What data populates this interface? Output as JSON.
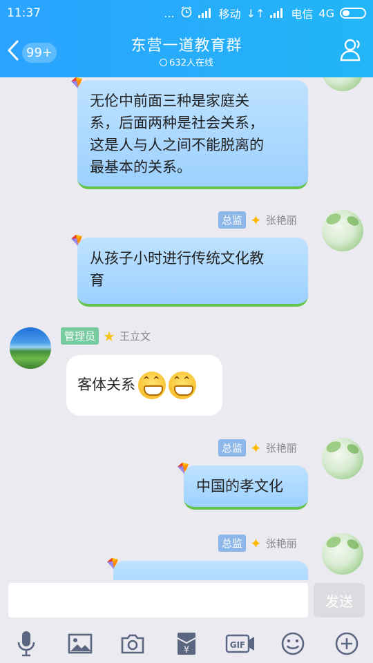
{
  "status": {
    "time": "11:37",
    "dots": "...",
    "carrier1": "移动",
    "carrier2": "电信",
    "network": "4G"
  },
  "header": {
    "back_badge": "99+",
    "title": "东营一道教育群",
    "online": "632人在线"
  },
  "messages": [
    {
      "text_lines": [
        "无伦中前面三种是家庭关",
        "系，后面两种是社会关系，",
        "这是人与人之间不能脱离的",
        "最基本的关系。"
      ]
    },
    {
      "role": "总监",
      "name": "张艳丽",
      "text_lines": [
        "从孩子小时进行传统文化教",
        "育"
      ]
    },
    {
      "role": "管理员",
      "name": "王立文",
      "text": "客体关系",
      "emoji": "grin-icon"
    },
    {
      "role": "总监",
      "name": "张艳丽",
      "text": "中国的孝文化"
    },
    {
      "role": "总监",
      "name": "张艳丽"
    }
  ],
  "input": {
    "send_label": "发送",
    "value": ""
  },
  "toolbar": {
    "gif_label": "GIF"
  }
}
